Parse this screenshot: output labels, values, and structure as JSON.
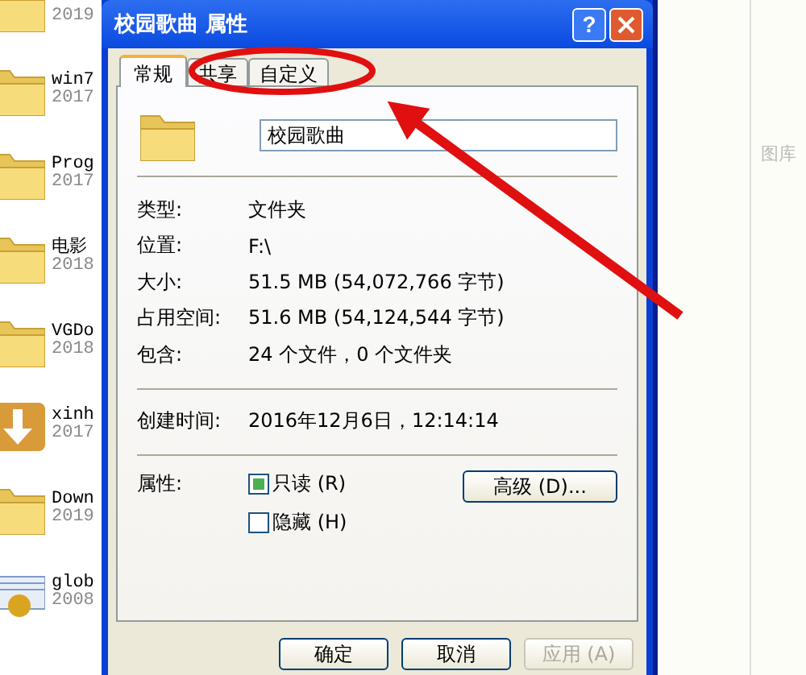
{
  "explorer": {
    "items": [
      {
        "kind": "folder",
        "date": "2019"
      },
      {
        "kind": "folder",
        "name": "win7",
        "date": "2017"
      },
      {
        "kind": "folder",
        "name": "Prog",
        "date": "2017"
      },
      {
        "kind": "folder",
        "name": "电影",
        "date": "2018"
      },
      {
        "kind": "folder",
        "name": "VGDo",
        "date": "2018"
      },
      {
        "kind": "download",
        "name": "xinh",
        "date": "2017"
      },
      {
        "kind": "folder",
        "name": "Down",
        "date": "2019"
      },
      {
        "kind": "file",
        "name": "glob",
        "date": "2008"
      }
    ]
  },
  "dialog": {
    "title": "校园歌曲 属性",
    "help": "?",
    "tabs": [
      {
        "label": "常规",
        "selected": true
      },
      {
        "label": "共享",
        "selected": false
      },
      {
        "label": "自定义",
        "selected": false
      }
    ],
    "name_field": {
      "value": "校园歌曲"
    },
    "groups": [
      [
        {
          "label": "类型:",
          "value": "文件夹"
        },
        {
          "label": "位置:",
          "value": "F:\\"
        },
        {
          "label": "大小:",
          "value": "51.5 MB (54,072,766 字节)"
        },
        {
          "label": "占用空间:",
          "value": "51.6 MB (54,124,544 字节)"
        },
        {
          "label": "包含:",
          "value": "24 个文件，0 个文件夹"
        }
      ],
      [
        {
          "label": "创建时间:",
          "value": "2016年12月6日，12:14:14"
        }
      ]
    ],
    "attributes": {
      "label": "属性:",
      "checkboxes": [
        {
          "label": "只读 (R)",
          "checked": true
        },
        {
          "label": "隐藏 (H)",
          "checked": false
        }
      ],
      "advanced_button": "高级 (D)..."
    },
    "buttons": [
      {
        "label": "确定",
        "disabled": false
      },
      {
        "label": "取消",
        "disabled": false
      },
      {
        "label": "应用 (A)",
        "disabled": true
      }
    ]
  },
  "side_label": "图库"
}
